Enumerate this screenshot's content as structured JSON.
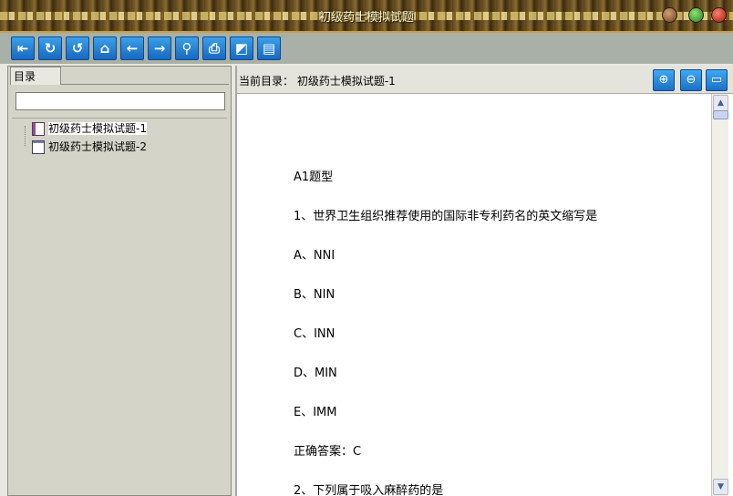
{
  "window": {
    "title": "初级药士模拟试题"
  },
  "toolbar": {
    "buttons": [
      {
        "name": "exit-icon",
        "glyph": "⇤"
      },
      {
        "name": "refresh-icon",
        "glyph": "↻"
      },
      {
        "name": "undo-icon",
        "glyph": "↺"
      },
      {
        "name": "home-icon",
        "glyph": "⌂"
      },
      {
        "name": "back-arrow-icon",
        "glyph": "←"
      },
      {
        "name": "forward-arrow-icon",
        "glyph": "→"
      },
      {
        "name": "search-icon",
        "glyph": "⚲"
      },
      {
        "name": "print-icon",
        "glyph": "⎙"
      },
      {
        "name": "bookmark-icon",
        "glyph": "◩"
      },
      {
        "name": "notes-icon",
        "glyph": "▤"
      }
    ]
  },
  "sidebar": {
    "tab_label": "目录",
    "search_value": "",
    "items": [
      {
        "label": "初级药士模拟试题-1",
        "icon": "book-icon"
      },
      {
        "label": "初级药士模拟试题-2",
        "icon": "page-icon"
      }
    ]
  },
  "main": {
    "current_dir_label": "当前目录：",
    "current_dir_value": "初级药士模拟试题-1",
    "zoom_in_glyph": "⊕",
    "zoom_out_glyph": "⊖",
    "fullscreen_glyph": "▭",
    "content_lines": [
      "A1题型",
      "1、世界卫生组织推荐使用的国际非专利药名的英文缩写是",
      "A、NNI",
      "B、NIN",
      "C、INN",
      "D、MIN",
      "E、IMM",
      "正确答案：C",
      "2、下列属于吸入麻醉药的是"
    ]
  },
  "scrollbar": {
    "up_glyph": "▲",
    "down_glyph": "▼"
  }
}
